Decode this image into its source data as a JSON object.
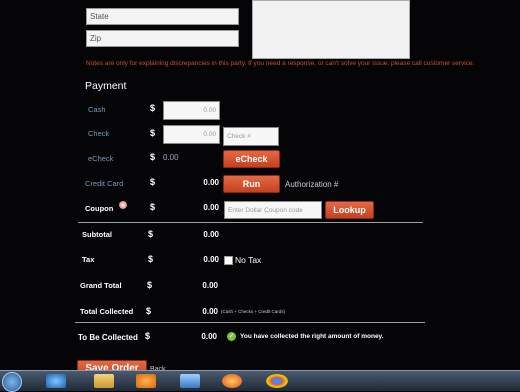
{
  "address": {
    "state_placeholder": "State",
    "zip_placeholder": "Zip"
  },
  "notes_warning": "Notes are only for explaining discrepancies in this party. If you need a response, or can't solve your issue, please call customer service.",
  "payment": {
    "heading": "Payment",
    "cash": {
      "label": "Cash",
      "currency": "$",
      "value": "0.00"
    },
    "check": {
      "label": "Check",
      "currency": "$",
      "value": "0.00",
      "number_placeholder": "Check #"
    },
    "echeck": {
      "label": "eCheck",
      "currency": "$",
      "value": "0.00",
      "button": "eCheck"
    },
    "credit_card": {
      "label": "Credit Card",
      "currency": "$",
      "value": "0.00",
      "button": "Run",
      "auth_label": "Authorization #"
    },
    "coupon": {
      "label": "Coupon",
      "currency": "$",
      "value": "0.00",
      "placeholder": "Enter Dollar Coupon code",
      "button": "Lookup"
    }
  },
  "totals": {
    "subtotal": {
      "label": "Subtotal",
      "currency": "$",
      "value": "0.00"
    },
    "tax": {
      "label": "Tax",
      "currency": "$",
      "value": "0.00",
      "no_tax_label": "No Tax"
    },
    "grand_total": {
      "label": "Grand Total",
      "currency": "$",
      "value": "0.00"
    },
    "total_collected": {
      "label": "Total Collected",
      "currency": "$",
      "value": "0.00",
      "note": "(Cash + Checks + Credit Cards)"
    },
    "to_be_collected": {
      "label": "To Be Collected",
      "currency": "$",
      "value": "0.00",
      "message": "You have collected the right amount of money."
    }
  },
  "actions": {
    "save_label": "Save Order",
    "back_label": "Back"
  },
  "colors": {
    "accent": "#d4552e",
    "success": "#7cc242",
    "warning_text": "#c8502a"
  },
  "taskbar": {
    "icons": [
      "windows-start-icon",
      "ie-icon",
      "explorer-icon",
      "media-player-icon",
      "control-panel-icon",
      "firefox-icon",
      "chrome-icon"
    ]
  }
}
